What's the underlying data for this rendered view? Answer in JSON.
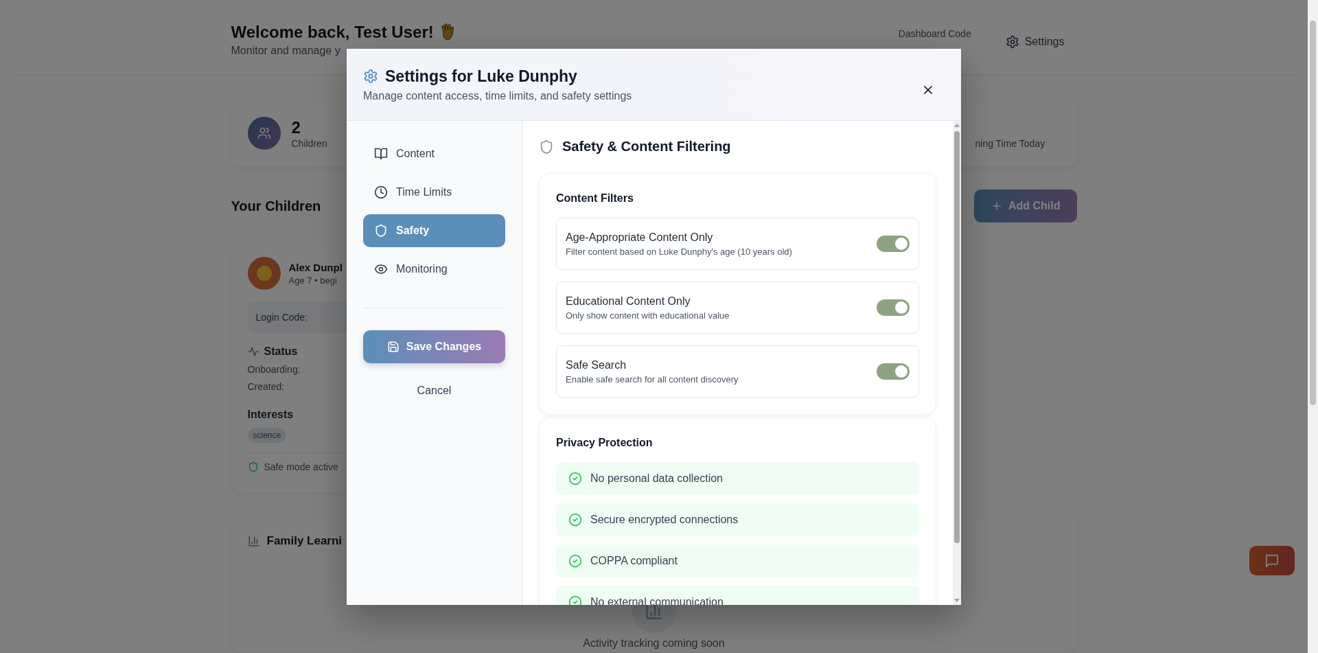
{
  "background_page": {
    "header": {
      "title": "Welcome back, Test User!",
      "subtitle": "Monitor and manage y",
      "dashboard_code_label": "Dashboard Code",
      "settings_button": "Settings"
    },
    "stats": [
      {
        "value": "2",
        "label": "Children"
      },
      {
        "label": "ning Time Today"
      }
    ],
    "children_section": {
      "title": "Your Children",
      "add_button": "Add Child"
    },
    "child_card": {
      "name": "Alex Dunpl",
      "meta": "Age 7 • begi",
      "login_code_label": "Login Code:",
      "status_title": "Status",
      "status_rows": [
        "Onboarding:",
        "Created:"
      ],
      "interests_title": "Interests",
      "interests": [
        "science"
      ],
      "safe_mode": "Safe mode active"
    },
    "activity_card": {
      "title": "Family Learni",
      "empty_text": "Activity tracking coming soon"
    }
  },
  "modal": {
    "title": "Settings for Luke Dunphy",
    "subtitle": "Manage content access, time limits, and safety settings",
    "nav": [
      {
        "label": "Content",
        "selected": false
      },
      {
        "label": "Time Limits",
        "selected": false
      },
      {
        "label": "Safety",
        "selected": true
      },
      {
        "label": "Monitoring",
        "selected": false
      }
    ],
    "save_button": "Save Changes",
    "cancel_button": "Cancel",
    "section_title": "Safety & Content Filtering",
    "content_filters": {
      "title": "Content Filters",
      "items": [
        {
          "title": "Age-Appropriate Content Only",
          "description": "Filter content based on Luke Dunphy's age (10 years old)",
          "on": true
        },
        {
          "title": "Educational Content Only",
          "description": "Only show content with educational value",
          "on": true
        },
        {
          "title": "Safe Search",
          "description": "Enable safe search for all content discovery",
          "on": true
        }
      ]
    },
    "privacy_protection": {
      "title": "Privacy Protection",
      "items": [
        "No personal data collection",
        "Secure encrypted connections",
        "COPPA compliant",
        "No external communication"
      ]
    }
  }
}
